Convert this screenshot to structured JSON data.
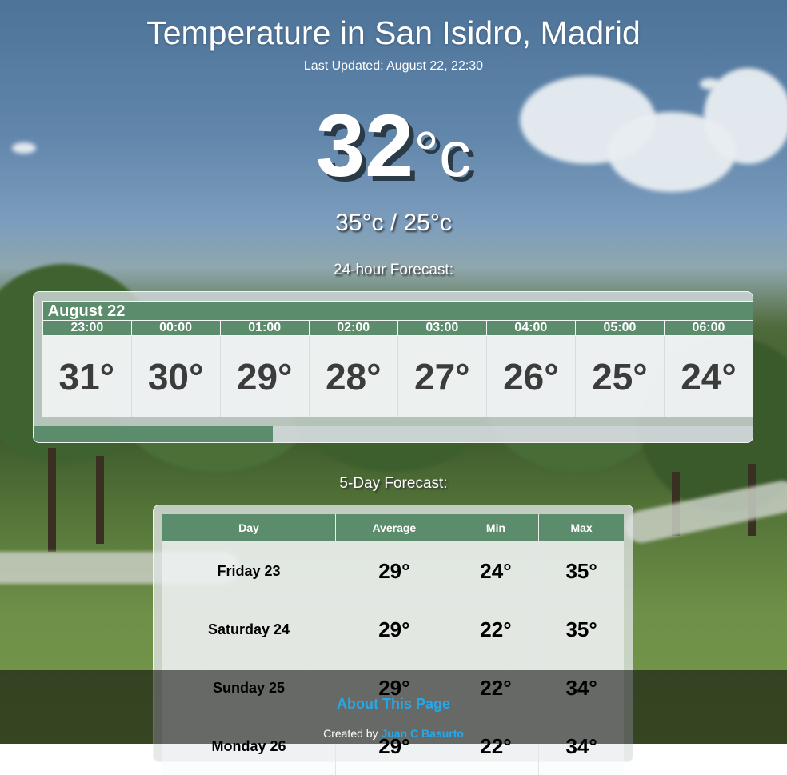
{
  "page": {
    "title": "Temperature in San Isidro, Madrid",
    "last_updated": "Last Updated: August 22, 22:30"
  },
  "current": {
    "temperature": "32",
    "unit": "°c",
    "high_low": "35°c / 25°c"
  },
  "hourly": {
    "heading": "24-hour Forecast:",
    "date": "August 22",
    "hours": [
      {
        "time": "23:00",
        "temp": "31°"
      },
      {
        "time": "00:00",
        "temp": "30°"
      },
      {
        "time": "01:00",
        "temp": "29°"
      },
      {
        "time": "02:00",
        "temp": "28°"
      },
      {
        "time": "03:00",
        "temp": "27°"
      },
      {
        "time": "04:00",
        "temp": "26°"
      },
      {
        "time": "05:00",
        "temp": "25°"
      },
      {
        "time": "06:00",
        "temp": "24°"
      }
    ],
    "scroll_position": 0
  },
  "daily": {
    "heading": "5-Day Forecast:",
    "columns": [
      "Day",
      "Average",
      "Min",
      "Max"
    ],
    "rows": [
      {
        "day": "Friday 23",
        "average": "29°",
        "min": "24°",
        "max": "35°"
      },
      {
        "day": "Saturday 24",
        "average": "29°",
        "min": "22°",
        "max": "35°"
      },
      {
        "day": "Sunday 25",
        "average": "29°",
        "min": "22°",
        "max": "34°"
      },
      {
        "day": "Monday 26",
        "average": "29°",
        "min": "22°",
        "max": "34°"
      }
    ]
  },
  "footer": {
    "about_link": "About This Page",
    "created_by": "Created by",
    "author_link": "Juan C Basurto"
  },
  "colors": {
    "accent_green": "#5b8d6c",
    "link_blue": "#28a7e8"
  }
}
